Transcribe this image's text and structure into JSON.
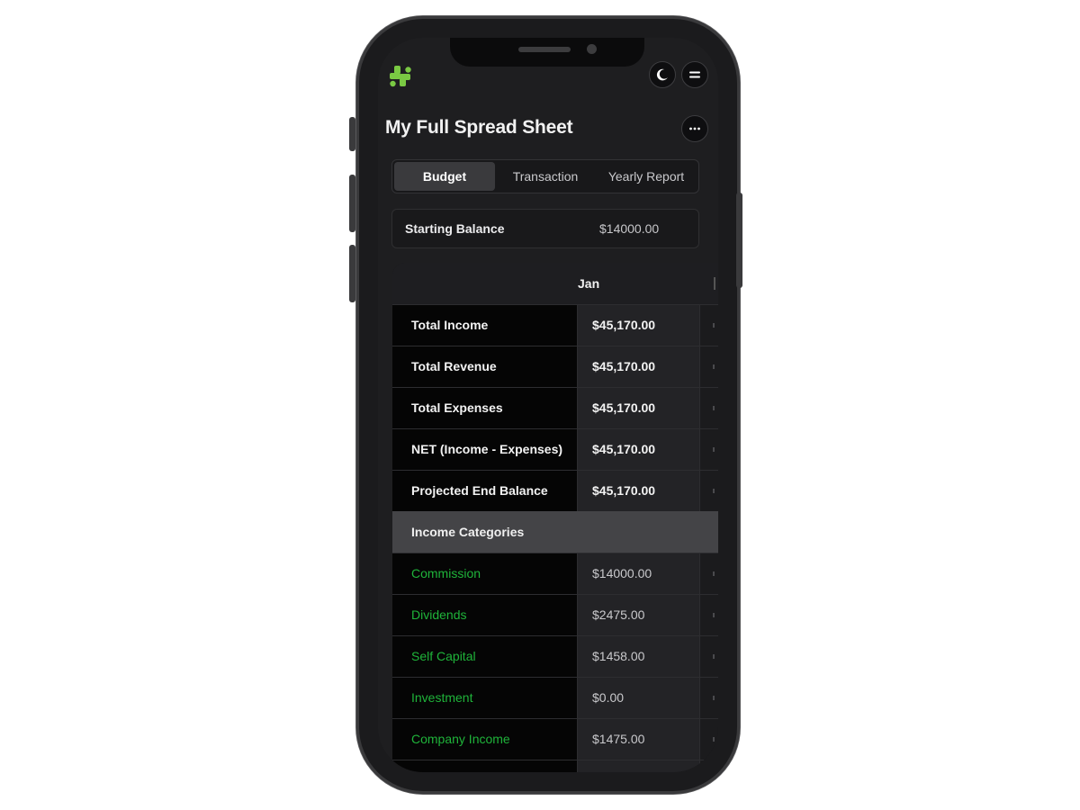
{
  "app": {
    "title": "My Full Spread Sheet"
  },
  "tabs": [
    {
      "label": "Budget",
      "active": true
    },
    {
      "label": "Transaction",
      "active": false
    },
    {
      "label": "Yearly Report",
      "active": false
    }
  ],
  "starting_balance": {
    "label": "Starting Balance",
    "value": "$14000.00"
  },
  "table": {
    "month_header": "Jan",
    "summary_rows": [
      {
        "label": "Total Income",
        "value": "$45,170.00"
      },
      {
        "label": "Total Revenue",
        "value": "$45,170.00"
      },
      {
        "label": "Total Expenses",
        "value": "$45,170.00"
      },
      {
        "label": "NET (Income - Expenses)",
        "value": "$45,170.00"
      },
      {
        "label": "Projected End Balance",
        "value": "$45,170.00"
      }
    ],
    "income_section_title": "Income Categories",
    "income_rows": [
      {
        "label": "Commission",
        "value": "$14000.00"
      },
      {
        "label": "Dividends",
        "value": "$2475.00"
      },
      {
        "label": "Self Capital",
        "value": "$1458.00"
      },
      {
        "label": "Investment",
        "value": "$0.00"
      },
      {
        "label": "Company Income",
        "value": "$1475.00"
      }
    ]
  },
  "icons": {
    "logo": "app-logo-icon",
    "theme_toggle": "moon-icon",
    "menu": "hamburger-menu-icon",
    "more": "more-options-icon"
  },
  "colors": {
    "accent_green": "#1fb43a",
    "logo_green": "#7ac943",
    "screen_bg": "#1e1e20"
  }
}
